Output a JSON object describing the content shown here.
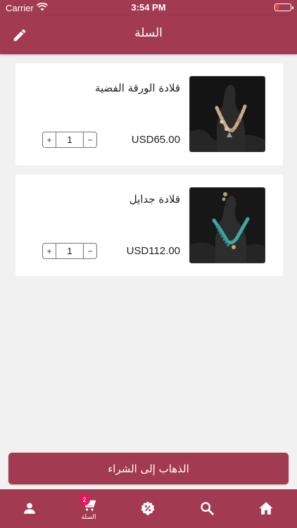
{
  "status_bar": {
    "carrier": "Carrier",
    "time": "3:54 PM"
  },
  "header": {
    "title": "السلة",
    "edit_icon": "pencil-icon"
  },
  "cart": {
    "items": [
      {
        "name": "قلادة الورقة الفضية",
        "price": "USD65.00",
        "quantity": "1",
        "plus_label": "+",
        "minus_label": "−"
      },
      {
        "name": "قلادة جدايل",
        "price": "USD112.00",
        "quantity": "1",
        "plus_label": "+",
        "minus_label": "−"
      }
    ]
  },
  "checkout": {
    "label": "الذهاب إلى الشراء"
  },
  "tab_bar": {
    "tabs": [
      {
        "icon": "profile-icon",
        "label": ""
      },
      {
        "icon": "cart-icon",
        "label": "السلة",
        "badge": "2",
        "active": true
      },
      {
        "icon": "offers-icon",
        "label": ""
      },
      {
        "icon": "search-icon",
        "label": ""
      },
      {
        "icon": "home-icon",
        "label": ""
      }
    ]
  },
  "colors": {
    "primary": "#a23a52",
    "badge": "#e0195f",
    "background": "#f1f1f1"
  }
}
